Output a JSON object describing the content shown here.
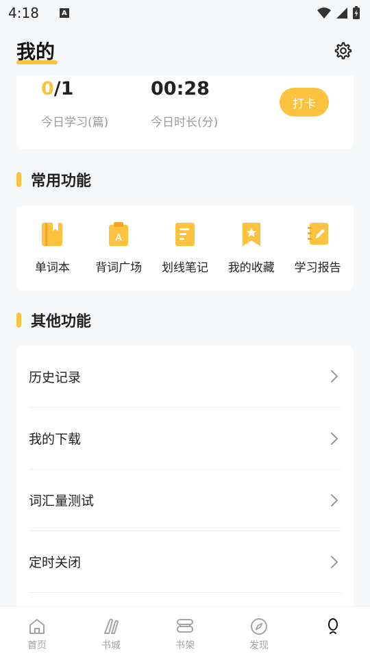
{
  "status_bar": {
    "time": "4:18",
    "notification_icon": "A"
  },
  "header": {
    "title": "我的",
    "settings_icon": "gear-icon"
  },
  "stats": {
    "articles_done": "0",
    "articles_total": "/1",
    "articles_label": "今日学习(篇)",
    "duration_value": "00:28",
    "duration_label": "今日时长(分)",
    "checkin_label": "打卡"
  },
  "common_functions": {
    "title": "常用功能",
    "items": [
      {
        "label": "单词本",
        "icon": "notebook-icon"
      },
      {
        "label": "背词广场",
        "icon": "clipboard-a-icon"
      },
      {
        "label": "划线笔记",
        "icon": "note-icon"
      },
      {
        "label": "我的收藏",
        "icon": "bookmark-star-icon"
      },
      {
        "label": "学习报告",
        "icon": "report-pencil-icon"
      }
    ]
  },
  "other_functions": {
    "title": "其他功能",
    "items": [
      {
        "label": "历史记录"
      },
      {
        "label": "我的下载"
      },
      {
        "label": "词汇量测试"
      },
      {
        "label": "定时关闭"
      }
    ]
  },
  "bottom_nav": {
    "items": [
      {
        "label": "首页",
        "icon": "home-icon"
      },
      {
        "label": "书城",
        "icon": "bookstore-icon"
      },
      {
        "label": "书架",
        "icon": "bookshelf-icon"
      },
      {
        "label": "发现",
        "icon": "compass-icon"
      },
      {
        "label": "",
        "icon": "profile-icon",
        "active": true
      }
    ]
  },
  "colors": {
    "accent": "#fbc33f",
    "background": "#f6f7f9",
    "muted_text": "#9a9a9a"
  }
}
